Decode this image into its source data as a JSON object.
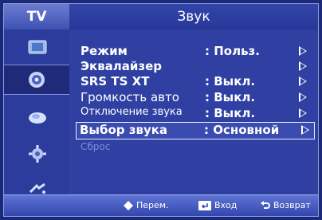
{
  "header": {
    "tv_tab": "TV",
    "title": "Звук"
  },
  "sidebar": {
    "icons": [
      "picture-icon",
      "sound-icon",
      "channel-icon",
      "setup-icon",
      "input-icon",
      "apps-icon"
    ]
  },
  "menu": {
    "rows": [
      {
        "label": "Режим",
        "value": ": Польз."
      },
      {
        "label": "Эквалайзер",
        "value": ""
      },
      {
        "label": "SRS TS XT",
        "value": ": Выкл."
      },
      {
        "label": "Громкость авто",
        "value": ": Выкл."
      },
      {
        "label": "Отключение звука",
        "value": ": Выкл."
      },
      {
        "label": "Выбор звука",
        "value": ": Основной"
      },
      {
        "label": "Сброс",
        "value": ""
      }
    ]
  },
  "footer": {
    "move_label": "Перем.",
    "enter_label": "Вход",
    "return_label": "Возврат"
  },
  "colors": {
    "background": "#2f40a2",
    "highlight_border": "#e8ecff",
    "disabled_text": "#7d8ed8"
  }
}
